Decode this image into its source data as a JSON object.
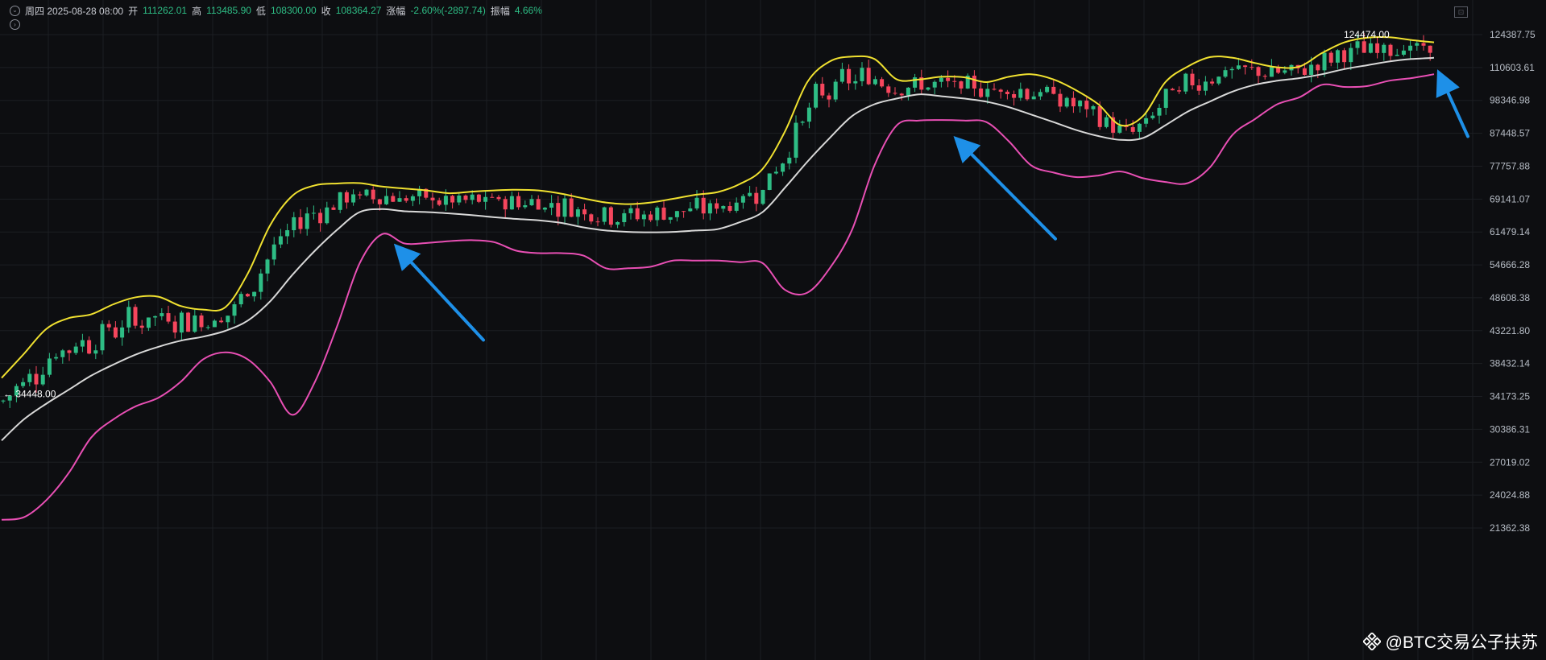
{
  "header": {
    "date": "周四 2025-08-28 08:00",
    "open_label": "开",
    "open": "111262.01",
    "high_label": "高",
    "high": "113485.90",
    "low_label": "低",
    "low": "108300.00",
    "close_label": "收",
    "close": "108364.27",
    "change_label": "涨幅",
    "change": "-2.60%(-2897.74)",
    "amplitude_label": "振幅",
    "amplitude": "4.66%"
  },
  "watermark": {
    "text": "@BTC交易公子扶苏"
  },
  "colors": {
    "background": "#0d0e11",
    "up": "#2ebd85",
    "down": "#f6465d",
    "upper_band": "#f0e130",
    "middle_band": "#d8d8d8",
    "lower_band": "#e84fb4",
    "arrow": "#1e90e8",
    "grid": "#1c1e23",
    "axis_text": "#b7bdc6"
  },
  "icons": {
    "collapse": "chevron-down-icon",
    "expand": "chevron-right-icon",
    "layout": "layout-icon",
    "logo": "binance-logo-icon"
  },
  "chart_data": {
    "type": "candlestick",
    "indicator": "bollinger",
    "y_axis": {
      "scale": "log",
      "ticks": [
        124387.75,
        110603.61,
        98346.98,
        87448.57,
        77757.88,
        69141.07,
        61479.14,
        54666.28,
        48608.38,
        43221.8,
        38432.14,
        34173.25,
        30386.31,
        27019.02,
        24024.88,
        21362.38
      ],
      "tick_labels": [
        "124387.75",
        "110603.61",
        "98346.98",
        "87448.57",
        "77757.88",
        "69141.07",
        "61479.14",
        "54666.28",
        "48608.38",
        "43221.80",
        "38432.14",
        "34173.25",
        "30386.31",
        "27019.02",
        "24024.88",
        "21362.38"
      ]
    },
    "annotations": [
      {
        "text": "124474.00",
        "value": 124474.0,
        "type": "max"
      },
      {
        "text": "← 34448.00",
        "value": 34448.0,
        "type": "min"
      }
    ],
    "grid": true,
    "series": [
      {
        "key": "upper",
        "values": [
          36500,
          39800,
          43500,
          45200,
          45800,
          47500,
          48700,
          48800,
          47200,
          46600,
          47000,
          53000,
          63000,
          70000,
          72600,
          73100,
          73200,
          72300,
          71800,
          71300,
          70600,
          71000,
          71300,
          71500,
          71300,
          70500,
          69300,
          68300,
          67900,
          68300,
          69200,
          70200,
          70900,
          73000,
          77000,
          88000,
          105000,
          113000,
          115000,
          114000,
          106000,
          106000,
          107000,
          106800,
          105000,
          107000,
          108000,
          106000,
          102000,
          97000,
          90000,
          93000,
          105000,
          111000,
          114800,
          114500,
          112400,
          110700,
          111000,
          116500,
          121000,
          123000,
          123200,
          122000,
          121000
        ]
      },
      {
        "key": "middle",
        "values": [
          29200,
          31500,
          33300,
          35000,
          36800,
          38300,
          39700,
          40800,
          41700,
          42300,
          43200,
          44800,
          48000,
          52800,
          57500,
          62000,
          66000,
          66700,
          66200,
          66000,
          65700,
          65300,
          64800,
          64400,
          64100,
          63500,
          62500,
          61800,
          61500,
          61400,
          61500,
          61800,
          62100,
          63700,
          66000,
          72000,
          79000,
          86000,
          93000,
          97000,
          99000,
          100500,
          99800,
          99000,
          97900,
          96000,
          93500,
          91000,
          88500,
          86600,
          85400,
          86000,
          90000,
          94500,
          98000,
          101500,
          104000,
          105500,
          106500,
          108000,
          110000,
          111500,
          113000,
          114000,
          114500
        ]
      },
      {
        "key": "lower",
        "values": [
          22000,
          22200,
          23600,
          26000,
          29500,
          31500,
          33000,
          34000,
          36000,
          39000,
          40000,
          39000,
          36000,
          32000,
          36000,
          44000,
          55000,
          61000,
          59000,
          59100,
          59500,
          59700,
          59300,
          57500,
          57000,
          57000,
          56500,
          54000,
          54000,
          54300,
          55500,
          55500,
          55500,
          55200,
          55000,
          50000,
          49500,
          54000,
          62000,
          78000,
          90000,
          91500,
          91700,
          91500,
          91000,
          85000,
          78000,
          76000,
          74800,
          75200,
          76300,
          74500,
          73500,
          73200,
          77500,
          87000,
          92000,
          97000,
          99500,
          104000,
          103200,
          103500,
          105500,
          106500,
          108000
        ]
      }
    ],
    "arrows": [
      {
        "tail_value": 41800,
        "head_value": 57500
      },
      {
        "tail_value": 60000,
        "head_value": 84500
      },
      {
        "tail_value": 86500,
        "head_value": 106500
      }
    ]
  }
}
